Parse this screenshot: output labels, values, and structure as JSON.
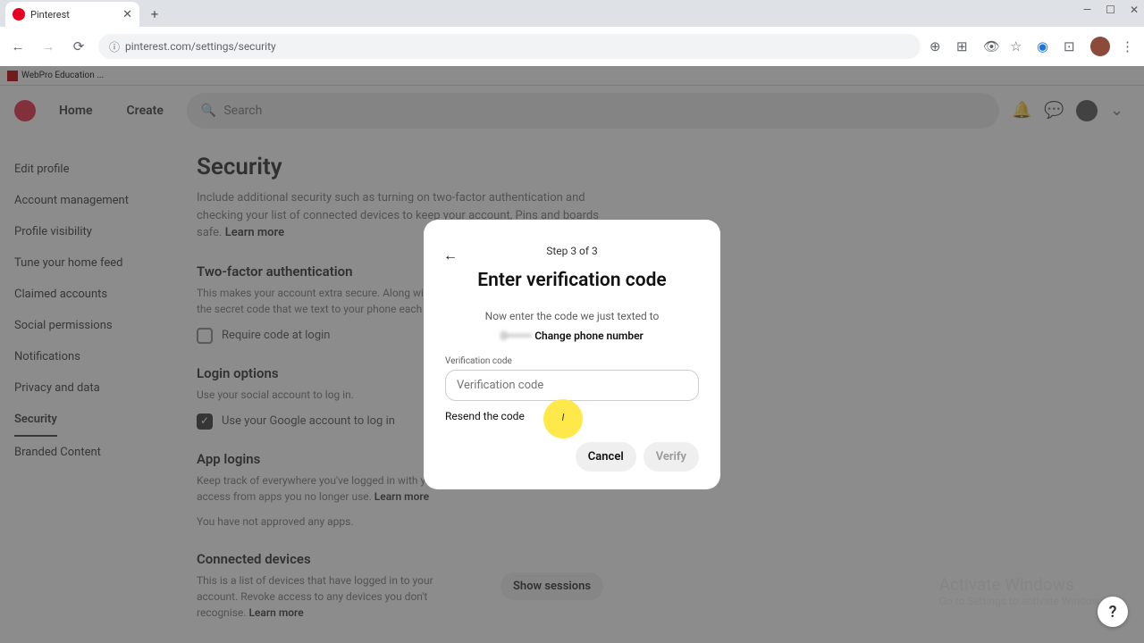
{
  "browser": {
    "tab_title": "Pinterest",
    "url": "pinterest.com/settings/security",
    "bookmark": "WebPro Education ..."
  },
  "header": {
    "home": "Home",
    "create": "Create",
    "search_placeholder": "Search"
  },
  "sidebar": {
    "items": [
      "Edit profile",
      "Account management",
      "Profile visibility",
      "Tune your home feed",
      "Claimed accounts",
      "Social permissions",
      "Notifications",
      "Privacy and data",
      "Security",
      "Branded Content"
    ],
    "active_index": 8
  },
  "page": {
    "title": "Security",
    "desc": "Include additional security such as turning on two-factor authentication and checking your list of connected devices to keep your account, Pins and boards safe.",
    "learn_more": "Learn more",
    "twofa_title": "Two-factor authentication",
    "twofa_desc": "This makes your account extra secure. Along with your password, you'll need to enter the secret code that we text to your phone each time you log in.",
    "twofa_check": "Require code at login",
    "login_title": "Login options",
    "login_desc": "Use your social account to log in.",
    "login_check": "Use your Google account to log in",
    "app_title": "App logins",
    "app_desc": "Keep track of everywhere you've logged in with your social accounts and remove access from apps you no longer use.",
    "app_none": "You have not approved any apps.",
    "devices_title": "Connected devices",
    "devices_desc": "This is a list of devices that have logged in to your account. Revoke access to any devices you don't recognise.",
    "show_sessions": "Show sessions"
  },
  "modal": {
    "step": "Step 3 of 3",
    "title": "Enter verification code",
    "desc": "Now enter the code we just texted to",
    "phone": "0•••••••",
    "change_phone": "Change phone number",
    "input_label": "Verification code",
    "input_placeholder": "Verification code",
    "resend": "Resend the code",
    "cancel": "Cancel",
    "verify": "Verify"
  },
  "activate": {
    "title": "Activate Windows",
    "sub": "Go to Settings to activate Windows."
  }
}
